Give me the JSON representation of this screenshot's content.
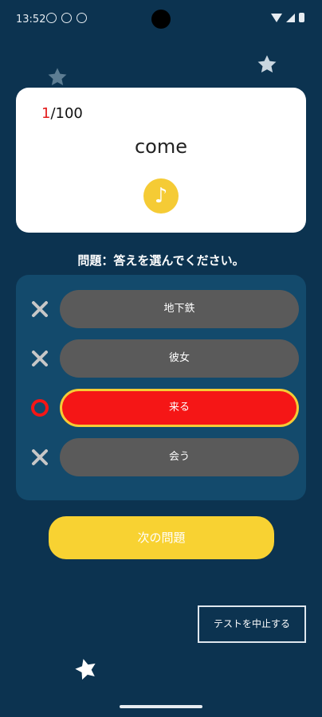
{
  "status_bar": {
    "time": "13:52",
    "left_icons": [
      "info-icon",
      "no-disturb-icon",
      "app-icon"
    ],
    "right_icons": [
      "wifi-icon",
      "signal-icon",
      "battery-icon"
    ]
  },
  "card": {
    "progress_current": "1",
    "progress_total": "/100",
    "word": "come",
    "audio_symbol": "♪"
  },
  "question": "問題：答えを選んでください。",
  "choices": [
    {
      "label": "地下鉄",
      "mark": "wrong"
    },
    {
      "label": "彼女",
      "mark": "wrong"
    },
    {
      "label": "来る",
      "mark": "correct"
    },
    {
      "label": "会う",
      "mark": "wrong"
    }
  ],
  "next_button": "次の問題",
  "quit_button": "テストを中止する",
  "colors": {
    "background": "#0c3350",
    "panel": "#134a6c",
    "accent_yellow": "#f8d232",
    "correct_red": "#f51616",
    "choice_gray": "#5a5a5a"
  }
}
